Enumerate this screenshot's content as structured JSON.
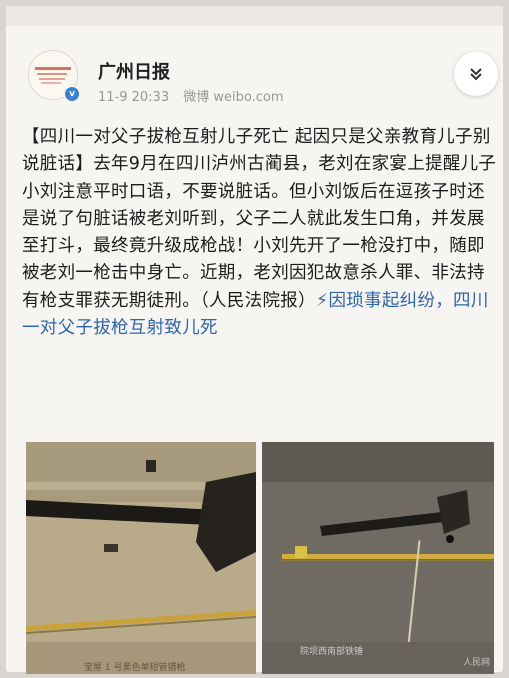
{
  "account": {
    "name": "广州日报",
    "time": "11-9 20:33",
    "source": "微博 weibo.com",
    "verified": "v"
  },
  "post": {
    "part1": "【四川一对父子拔枪互射儿子死亡 起因只是父亲教育儿子别说脏话】去年9月在四川泸州古蔺县，老刘在家宴上提醒儿子小刘注意平时口语，不要说脏话。但小刘饭后在逗孩子时还是说了句脏话被老刘听到，父子二人就此发生口角，并发展至打斗，最终竟升级成枪战！小刘先开了一枪没打中，随即被老刘一枪击中身亡。近期，老刘因犯故意杀人罪、非法持有枪支罪获无期徒刑。（人民法院报）",
    "link_icon": "⚡",
    "link_text": "因琐事起纠纷，四川一对父子拔枪互射致儿死"
  },
  "photos": [
    {
      "caption": "堂屋 1 号黑色单短管猎枪"
    },
    {
      "caption": "院坝西南部铁锤",
      "watermark": "人民网"
    }
  ],
  "colors": {
    "link": "#2f66b3",
    "verified": "#3a80d6"
  },
  "icons": {
    "expand": "chevron-double-down-icon"
  }
}
